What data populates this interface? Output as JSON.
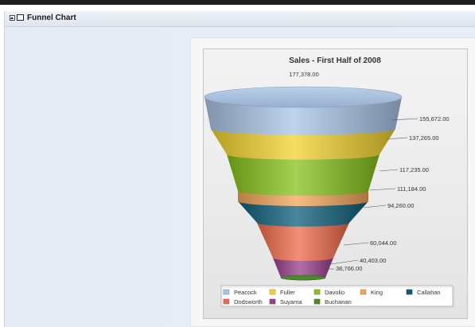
{
  "window": {
    "title": "Funnel Chart"
  },
  "chart_data": {
    "type": "funnel",
    "title": "Sales - First Half of 2008",
    "series": [
      {
        "name": "Peacock",
        "value": 177378.0,
        "label": "177,378.00",
        "color": "#a9c4e6"
      },
      {
        "name": "Fuller",
        "value": 155672.0,
        "label": "155,672.00",
        "color": "#f2d22e"
      },
      {
        "name": "Davolio",
        "value": 137265.0,
        "label": "137,265.00",
        "color": "#86c21b"
      },
      {
        "name": "King",
        "value": 117235.0,
        "label": "117,235.00",
        "color": "#f4a65a"
      },
      {
        "name": "Callahan",
        "value": 111184.0,
        "label": "111,184.00",
        "color": "#0b5e7a"
      },
      {
        "name": "Dodsworth",
        "value": 94260.0,
        "label": "94,260.00",
        "color": "#f06a4a"
      },
      {
        "name": "Suyama",
        "value": 60044.0,
        "label": "60,044.00",
        "color": "#9a3e8c"
      },
      {
        "name": "Buchanan",
        "value": 40403.0,
        "label": "40,403.00",
        "color": "#4a8a2c"
      }
    ],
    "extra_labels": [
      "38,766.00"
    ],
    "legend": {
      "position": "bottom"
    }
  }
}
